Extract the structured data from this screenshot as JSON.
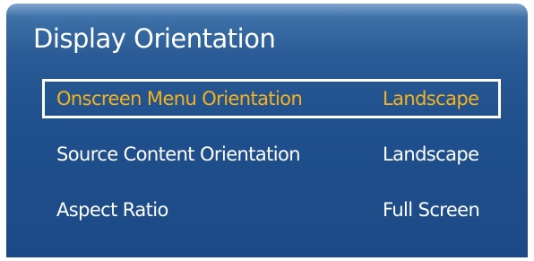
{
  "panel": {
    "title": "Display Orientation",
    "accent_color": "#f6b21c",
    "background_color": "#24548f"
  },
  "menu": {
    "items": [
      {
        "label": "Onscreen Menu Orientation",
        "value": "Landscape",
        "selected": true
      },
      {
        "label": "Source Content Orientation",
        "value": "Landscape",
        "selected": false
      },
      {
        "label": "Aspect Ratio",
        "value": "Full Screen",
        "selected": false
      }
    ]
  }
}
